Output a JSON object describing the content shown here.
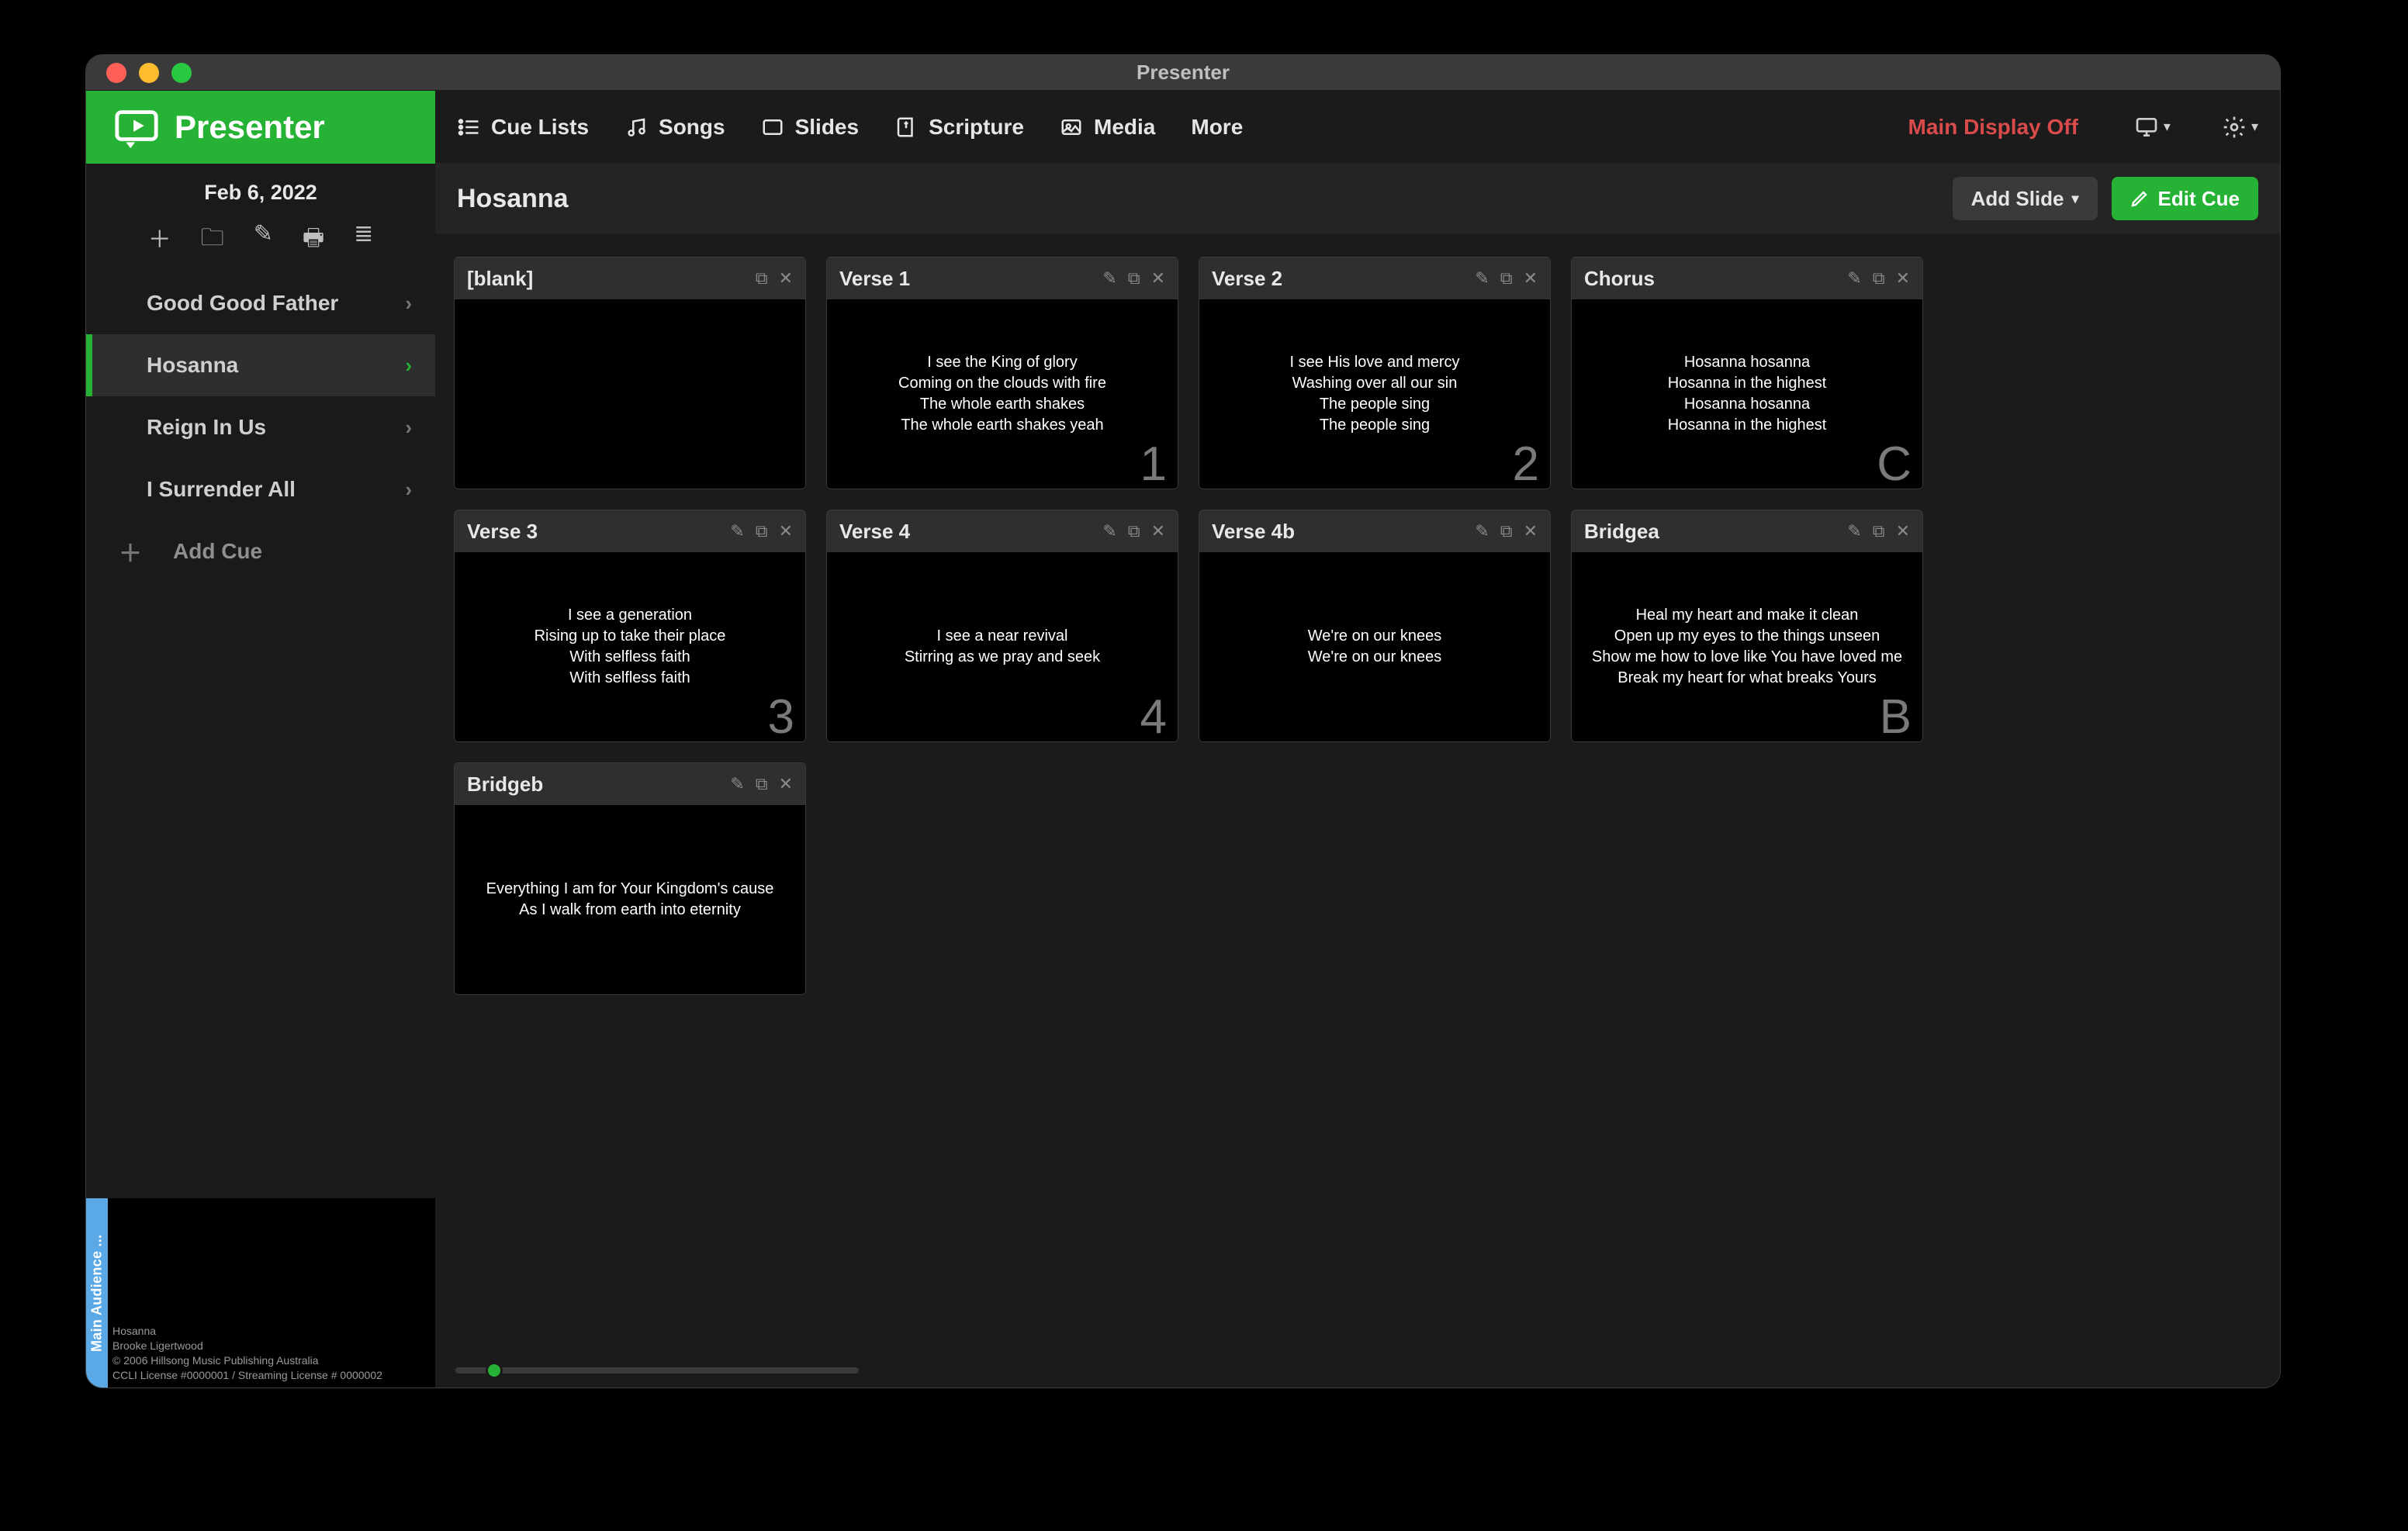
{
  "window_title": "Presenter",
  "logo_text": "Presenter",
  "date_label": "Feb 6, 2022",
  "nav": {
    "cue_lists": "Cue Lists",
    "songs": "Songs",
    "slides": "Slides",
    "scripture": "Scripture",
    "media": "Media",
    "more": "More"
  },
  "display_status": "Main Display Off",
  "song_title": "Hosanna",
  "add_slide_label": "Add Slide",
  "edit_cue_label": "Edit Cue",
  "add_cue_label": "Add Cue",
  "cues": [
    {
      "label": "Good Good Father",
      "active": false
    },
    {
      "label": "Hosanna",
      "active": true
    },
    {
      "label": "Reign In Us",
      "active": false
    },
    {
      "label": "I Surrender All",
      "active": false
    }
  ],
  "slides": [
    {
      "label": "[blank]",
      "text": "",
      "key": "",
      "has_edit": false
    },
    {
      "label": "Verse 1",
      "text": "I see the King of glory\nComing on the clouds with fire\nThe whole earth shakes\nThe whole earth shakes yeah",
      "key": "1",
      "has_edit": true
    },
    {
      "label": "Verse 2",
      "text": "I see His love and mercy\nWashing over all our sin\nThe people sing\nThe people sing",
      "key": "2",
      "has_edit": true
    },
    {
      "label": "Chorus",
      "text": "Hosanna hosanna\nHosanna in the highest\nHosanna hosanna\nHosanna in the highest",
      "key": "C",
      "has_edit": true
    },
    {
      "label": "Verse 3",
      "text": "I see a generation\nRising up to take their place\nWith selfless faith\nWith selfless faith",
      "key": "3",
      "has_edit": true
    },
    {
      "label": "Verse 4",
      "text": "I see a near revival\nStirring as we pray and seek",
      "key": "4",
      "has_edit": true
    },
    {
      "label": "Verse 4b",
      "text": "We're on our knees\nWe're on our knees",
      "key": "",
      "has_edit": true
    },
    {
      "label": "Bridgea",
      "text": "Heal my heart and make it clean\nOpen up my eyes to the things unseen\nShow me how to love like You have loved me\nBreak my heart for what breaks Yours",
      "key": "B",
      "has_edit": true
    },
    {
      "label": "Bridgeb",
      "text": "Everything I am for Your Kingdom's cause\nAs I walk from earth into eternity",
      "key": "",
      "has_edit": true
    }
  ],
  "preview": {
    "tag": "Main Audience ...",
    "line1": "Hosanna",
    "line2": "Brooke Ligertwood",
    "line3": "© 2006 Hillsong Music Publishing Australia",
    "line4": "CCLI License #0000001 / Streaming License # 0000002"
  }
}
